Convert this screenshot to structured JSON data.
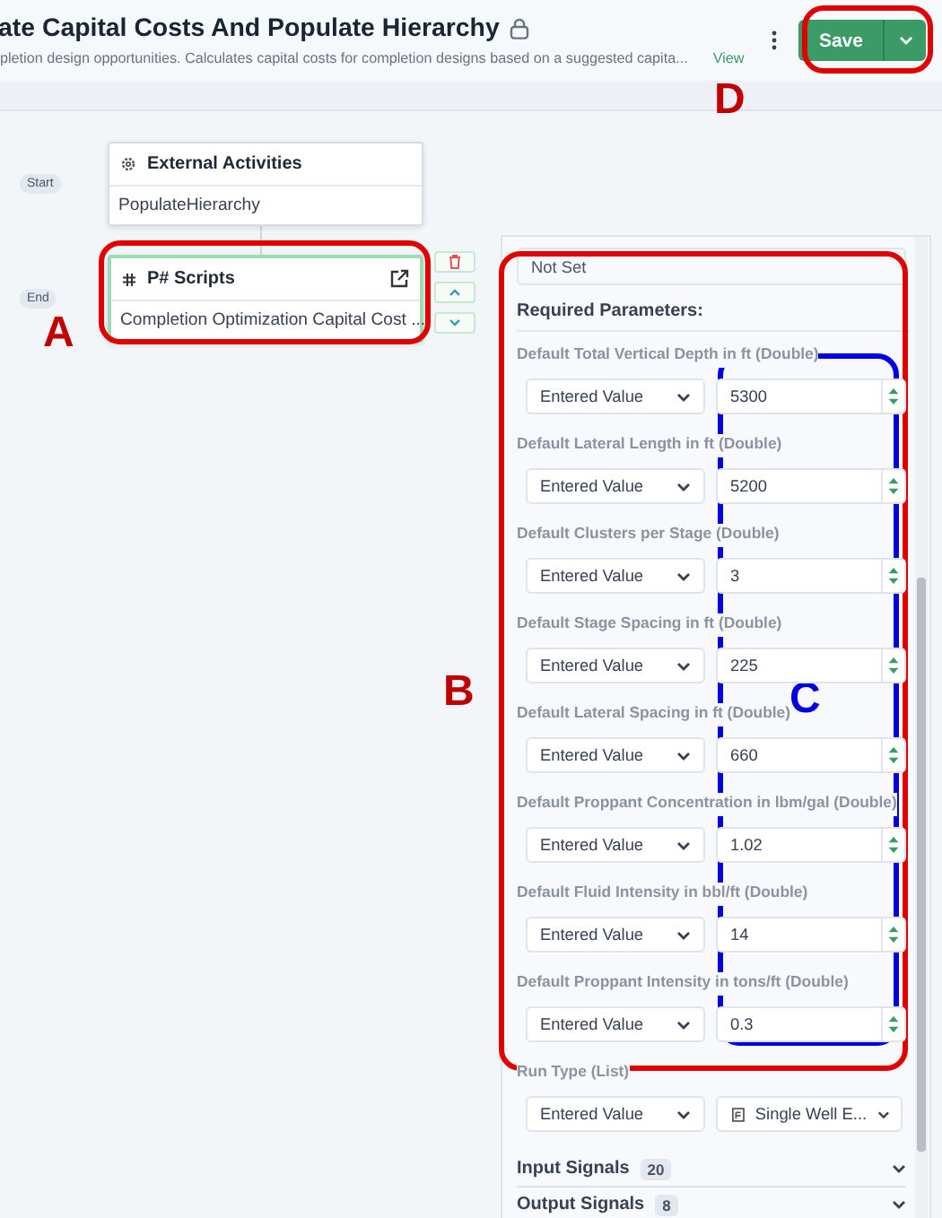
{
  "header": {
    "title": "ate Capital Costs And Populate Hierarchy",
    "description": "pletion design opportunities. Calculates capital costs for completion designs based on a suggested capita...",
    "view_link": "View",
    "save_button": "Save"
  },
  "flow": {
    "steps": [
      {
        "marker": "Start",
        "kind": "external",
        "title": "External Activities",
        "body": "PopulateHierarchy",
        "selected": false
      },
      {
        "marker": "End",
        "kind": "script",
        "title": "P# Scripts",
        "body": "Completion Optimization Capital Cost ...",
        "selected": true
      }
    ]
  },
  "panel": {
    "source_value": "Not Set",
    "section_title": "Required Parameters:",
    "parameters": [
      {
        "label": "Default Total Vertical Depth in ft (Double)",
        "mode": "Entered Value",
        "kind": "number",
        "value": "5300"
      },
      {
        "label": "Default Lateral Length in ft (Double)",
        "mode": "Entered Value",
        "kind": "number",
        "value": "5200"
      },
      {
        "label": "Default Clusters per Stage (Double)",
        "mode": "Entered Value",
        "kind": "number",
        "value": "3"
      },
      {
        "label": "Default Stage Spacing in ft (Double)",
        "mode": "Entered Value",
        "kind": "number",
        "value": "225"
      },
      {
        "label": "Default Lateral Spacing in ft (Double)",
        "mode": "Entered Value",
        "kind": "number",
        "value": "660"
      },
      {
        "label": "Default Proppant Concentration in lbm/gal (Double)",
        "mode": "Entered Value",
        "kind": "number",
        "value": "1.02"
      },
      {
        "label": "Default Fluid Intensity in bbl/ft (Double)",
        "mode": "Entered Value",
        "kind": "number",
        "value": "14"
      },
      {
        "label": "Default Proppant Intensity in tons/ft (Double)",
        "mode": "Entered Value",
        "kind": "number",
        "value": "0.3"
      },
      {
        "label": "Run Type (List)",
        "mode": "Entered Value",
        "kind": "list",
        "value": "Single Well E..."
      }
    ],
    "signals": [
      {
        "label": "Input Signals",
        "count": "20",
        "expanded": false
      },
      {
        "label": "Output Signals",
        "count": "8",
        "expanded": false
      }
    ]
  },
  "annotations": [
    {
      "letter": "A",
      "color": "#e00000"
    },
    {
      "letter": "B",
      "color": "#e00000"
    },
    {
      "letter": "C",
      "color": "#0000e0"
    },
    {
      "letter": "D",
      "color": "#e00000"
    }
  ]
}
